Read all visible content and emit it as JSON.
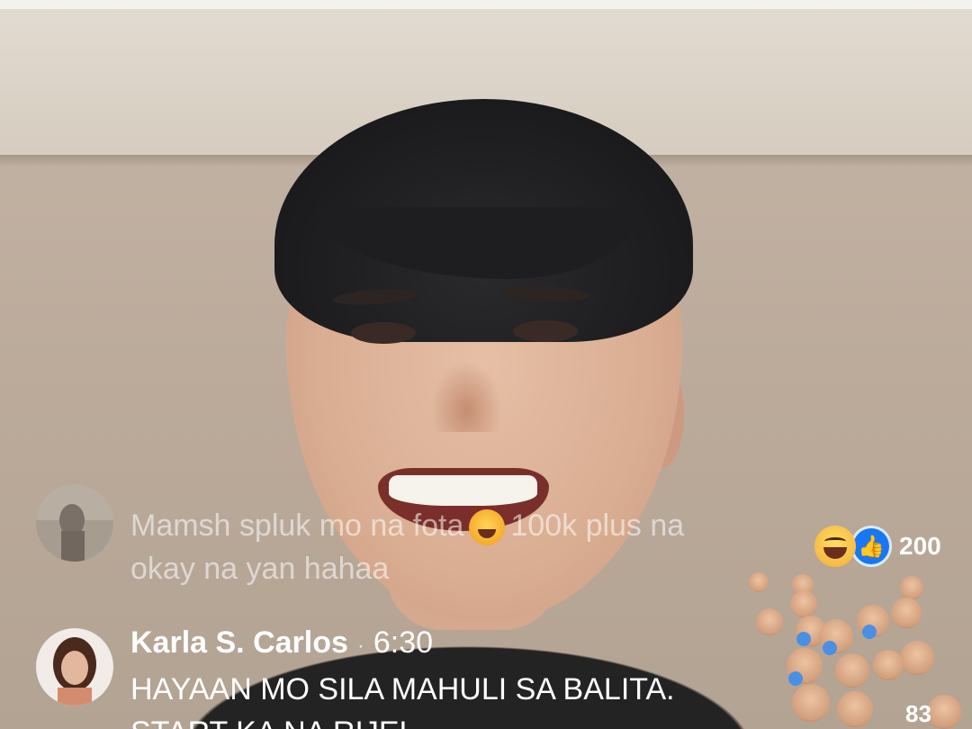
{
  "comments": [
    {
      "faded": true,
      "ghost_text": "",
      "text_before": "Mamsh spluk mo na fota",
      "emoji": "rolling-laughing-emoji",
      "text_after": "100k plus na",
      "text_line2": "okay na yan hahaa"
    },
    {
      "faded": false,
      "name": "Karla S. Carlos",
      "separator": "·",
      "time": "6:30",
      "text_line1": "HAYAAN MO SILA MAHULI SA BALITA.",
      "text_line2": "START KA NA RIJEL"
    }
  ],
  "reactions": {
    "types": [
      "haha-icon",
      "like-icon"
    ],
    "count": "200"
  },
  "floating_reactions": {
    "count_partial": "83"
  }
}
